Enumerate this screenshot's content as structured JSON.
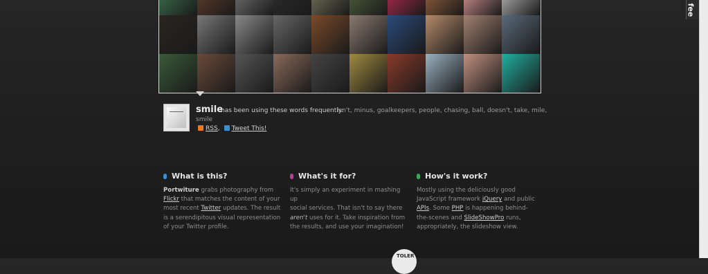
{
  "feed_tab": {
    "label": "fee"
  },
  "photo_grid": {
    "tiles": [
      "#3a6a4a",
      "#5a3a2a",
      "#6a6a6a",
      "#2a2a2a",
      "#6c6a55",
      "#4a5a3a",
      "#a22a4a",
      "#8a5a3a",
      "#c88a8a",
      "#aaaaaa",
      "#2a2520",
      "#777777",
      "#888888",
      "#666666",
      "#7a4a2a",
      "#8a7a70",
      "#2a4a7a",
      "#b48a6a",
      "#a08070",
      "#5a6a7a",
      "#3a5a3a",
      "#6a4a3a",
      "#555555",
      "#8a6a5a",
      "#444444",
      "#a08a40",
      "#8a3a2a",
      "#9ab0c0",
      "#c09080",
      "#20b0a0"
    ]
  },
  "tweet_info": {
    "username": "smile",
    "phrase": "has been using these words frequently:",
    "words_line1": "isn't, minus, goalkeepers, people, chasing, ball, doesn't, take, mile,",
    "words_line2": "smile",
    "rss_label": "RSS",
    "tweet_label": "Tweet This!"
  },
  "sections": [
    {
      "title": "What is this?",
      "color": "#3a8fd6",
      "lines": [
        [
          {
            "t": "Portwiture",
            "s": "b"
          },
          {
            "t": " grabs photography from",
            "s": ""
          }
        ],
        [
          {
            "t": "Flickr",
            "s": "u"
          },
          {
            "t": " that matches the content of your",
            "s": ""
          }
        ],
        [
          {
            "t": "most recent ",
            "s": ""
          },
          {
            "t": "Twitter",
            "s": "u"
          },
          {
            "t": " updates. The result",
            "s": ""
          }
        ],
        [
          {
            "t": "is a serendipitous visual representation",
            "s": ""
          }
        ],
        [
          {
            "t": "of your Twitter profile.",
            "s": ""
          }
        ]
      ]
    },
    {
      "title": "What's it for?",
      "color": "#c23a9a",
      "lines": [
        [
          {
            "t": "It's simply an experiment in mashing up",
            "s": ""
          }
        ],
        [
          {
            "t": "social services. That isn't to say there",
            "s": ""
          }
        ],
        [
          {
            "t": "aren't",
            "s": "i"
          },
          {
            "t": " uses for it. Take inspiration from",
            "s": ""
          }
        ],
        [
          {
            "t": "the results, and use your imagination!",
            "s": ""
          }
        ]
      ]
    },
    {
      "title": "How's it work?",
      "color": "#3aa85a",
      "lines": [
        [
          {
            "t": "Mostly using the deliciously good",
            "s": ""
          }
        ],
        [
          {
            "t": "JavaScript framework ",
            "s": ""
          },
          {
            "t": "jQuery",
            "s": "u"
          },
          {
            "t": " and public",
            "s": ""
          }
        ],
        [
          {
            "t": "APIs",
            "s": "u"
          },
          {
            "t": ". Some ",
            "s": ""
          },
          {
            "t": "PHP",
            "s": "u"
          },
          {
            "t": " is happening behind-",
            "s": ""
          }
        ],
        [
          {
            "t": "the-scenes and ",
            "s": ""
          },
          {
            "t": "SlideShowPro",
            "s": "u"
          },
          {
            "t": " runs,",
            "s": ""
          }
        ],
        [
          {
            "t": "appropriately, the slideshow view.",
            "s": ""
          }
        ]
      ]
    }
  ],
  "footer_badge": {
    "label": "TOLER"
  }
}
